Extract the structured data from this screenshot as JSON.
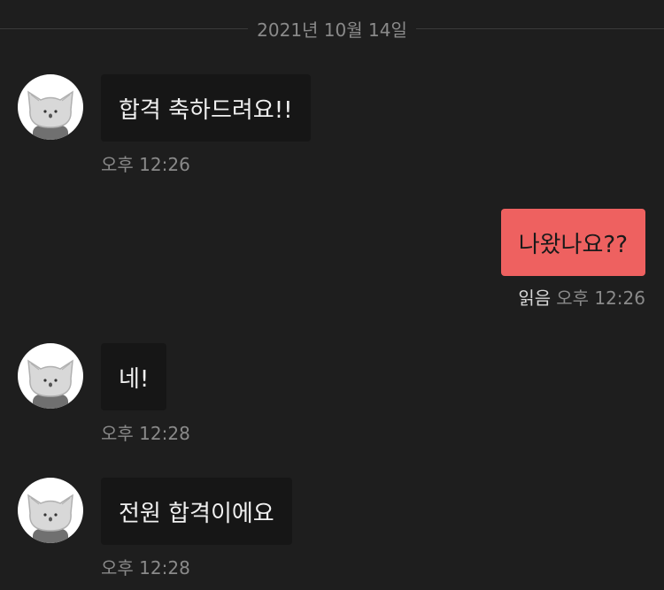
{
  "date_divider": "2021년 10월 14일",
  "messages": [
    {
      "direction": "in",
      "text": "합격 축하드려요!!",
      "time": "오후 12:26",
      "avatar_icon": "cat-avatar-icon"
    },
    {
      "direction": "out",
      "text": "나왔나요??",
      "time": "오후 12:26",
      "read_label": "읽음"
    },
    {
      "direction": "in",
      "text": "네!",
      "time": "오후 12:28",
      "avatar_icon": "cat-avatar-icon"
    },
    {
      "direction": "in",
      "text": "전원 합격이에요",
      "time": "오후 12:28",
      "avatar_icon": "cat-avatar-icon"
    }
  ],
  "colors": {
    "background": "#1e1e1e",
    "incoming_bubble": "#161616",
    "outgoing_bubble": "#ee6160",
    "meta_text": "#8a8a8a"
  }
}
